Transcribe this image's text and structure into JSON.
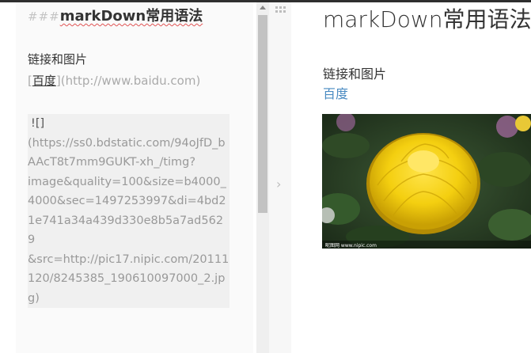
{
  "editor": {
    "heading_hash": "###",
    "heading_text": "markDown常用语法",
    "section_label": "链接和图片",
    "link_open": "[",
    "link_text": "百度",
    "link_close": "](http://www.baidu.com)",
    "image_bang": "![]",
    "image_url_lines": [
      "(https://ss0.bdstatic.com/94oJfD_b",
      "AAcT8t7mm9GUKT-xh_/timg?",
      "image&quality=100&size=b4000_",
      "4000&sec=1497253997&di=4bd2",
      "1e741a34a439d330e8b5a7ad5629",
      "&src=http://pic17.nipic.com/20111",
      "120/8245385_190610097000_2.jp",
      "g)"
    ]
  },
  "preview": {
    "title": "markDown常用语法",
    "section_label": "链接和图片",
    "link_text": "百度",
    "image_alt": "yellow chrysanthemum photo",
    "image_watermark": "昵图网 www.nipic.com"
  },
  "icons": {
    "divider_top": "grid-dots-icon",
    "divider_middle": "chevron-right-icon"
  },
  "colors": {
    "link": "#4a8bc2",
    "editor_bg": "#fafafa",
    "spell_error": "#e05555"
  }
}
